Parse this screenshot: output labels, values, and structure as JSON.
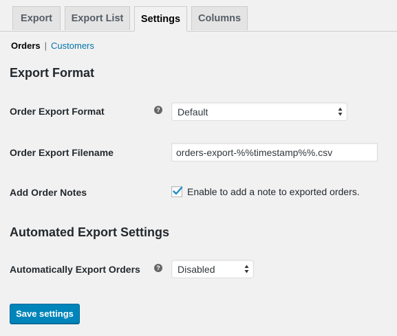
{
  "tabs": [
    {
      "label": "Export",
      "active": false
    },
    {
      "label": "Export List",
      "active": false
    },
    {
      "label": "Settings",
      "active": true
    },
    {
      "label": "Columns",
      "active": false
    }
  ],
  "subnav": {
    "current": "Orders",
    "separator": "|",
    "link": "Customers"
  },
  "export_format": {
    "heading": "Export Format",
    "format_label": "Order Export Format",
    "format_value": "Default",
    "filename_label": "Order Export Filename",
    "filename_value": "orders-export-%%timestamp%%.csv",
    "notes_label": "Add Order Notes",
    "notes_checked": true,
    "notes_text": "Enable to add a note to exported orders."
  },
  "automated": {
    "heading": "Automated Export Settings",
    "label": "Automatically Export Orders",
    "value": "Disabled"
  },
  "help_icon_glyph": "?",
  "save_button": "Save settings",
  "colors": {
    "accent": "#0085ba",
    "link": "#0073aa",
    "background": "#f1f1f1"
  }
}
